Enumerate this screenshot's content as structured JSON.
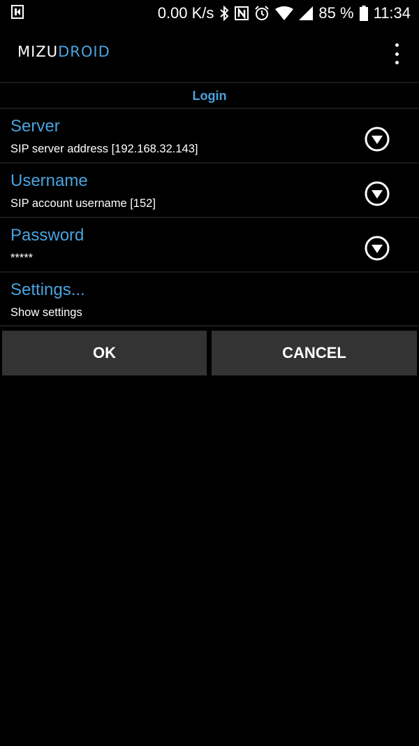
{
  "status_bar": {
    "network_speed": "0.00 K/s",
    "battery": "85 %",
    "time": "11:34",
    "icons": [
      "app-notification-icon",
      "bluetooth-icon",
      "nfc-icon",
      "alarm-icon",
      "wifi-icon",
      "signal-icon",
      "battery-icon"
    ]
  },
  "app_bar": {
    "logo_mizu": "MIZU",
    "logo_droid": "DROID",
    "overflow_icon": "more-vert-icon"
  },
  "section": {
    "title": "Login"
  },
  "preferences": [
    {
      "title": "Server",
      "summary": "SIP server address [192.168.32.143]",
      "icon": "dropdown-circle-icon"
    },
    {
      "title": "Username",
      "summary": "SIP account username [152]",
      "icon": "dropdown-circle-icon"
    },
    {
      "title": "Password",
      "summary": "*****",
      "icon": "dropdown-circle-icon"
    },
    {
      "title": "Settings...",
      "summary": "Show settings"
    }
  ],
  "buttons": {
    "ok": "OK",
    "cancel": "CANCEL"
  },
  "colors": {
    "accent": "#4aa3df",
    "background": "#000000",
    "button_bg": "#333333",
    "divider": "#1b1b1b"
  }
}
